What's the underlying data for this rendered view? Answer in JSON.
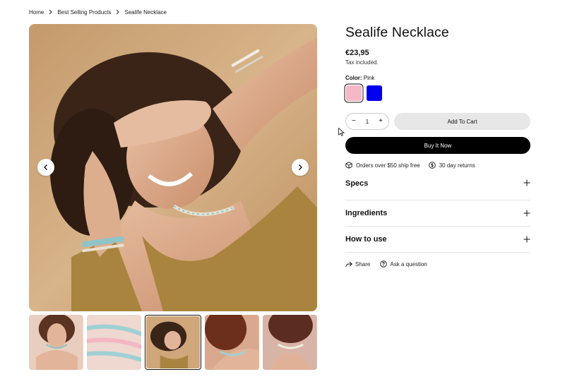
{
  "breadcrumb": {
    "items": [
      "Home",
      "Best Selling Products",
      "Sealife Necklace"
    ]
  },
  "product": {
    "title": "Sealife Necklace",
    "price": "€23,95",
    "tax_note": "Tax included.",
    "color_label": "Color:",
    "color_value": "Pink",
    "swatches": [
      {
        "name": "Pink",
        "color": "#f4b8c8",
        "selected": true
      },
      {
        "name": "Blue",
        "color": "#0000ee",
        "selected": false
      }
    ],
    "quantity": "1",
    "add_to_cart_label": "Add To Cart",
    "buy_now_label": "Buy It Now"
  },
  "perks": [
    {
      "icon": "box-icon",
      "text": "Orders over $50 ship free"
    },
    {
      "icon": "dollar-circle-icon",
      "text": "30 day returns"
    }
  ],
  "accordion": [
    "Specs",
    "Ingredients",
    "How to use"
  ],
  "actions": {
    "share_label": "Share",
    "ask_label": "Ask a question"
  },
  "gallery": {
    "thumbnail_count": 5,
    "active_index": 2
  },
  "colors": {
    "primary_button": "#000000",
    "secondary_button": "#e7e7e7"
  }
}
